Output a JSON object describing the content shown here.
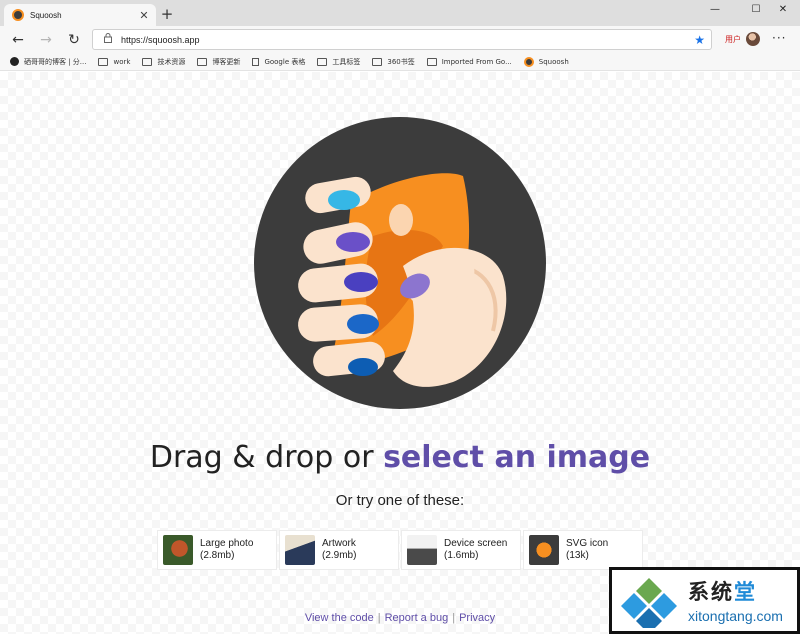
{
  "browser": {
    "tab_title": "Squoosh",
    "tab_close": "✕",
    "new_tab": "+",
    "window_controls": [
      "—",
      "☐",
      "✕"
    ],
    "nav": {
      "back": "←",
      "forward": "→",
      "refresh": "↻"
    },
    "url": "https://squoosh.app",
    "favorite_star": "★",
    "profile_label": "用户",
    "menu": "···",
    "bookmarks": [
      {
        "label": "硒哥哥的博客 | 分...",
        "icon": "circle-icon"
      },
      {
        "label": "work",
        "icon": "folder-icon"
      },
      {
        "label": "技术资源",
        "icon": "folder-icon"
      },
      {
        "label": "博客更新",
        "icon": "folder-icon"
      },
      {
        "label": "Google 表格",
        "icon": "page-icon"
      },
      {
        "label": "工具标签",
        "icon": "folder-icon"
      },
      {
        "label": "360书签",
        "icon": "folder-icon"
      },
      {
        "label": "Imported From Go...",
        "icon": "folder-icon"
      },
      {
        "label": "Squoosh",
        "icon": "squoosh-icon"
      }
    ]
  },
  "page": {
    "headline_prefix": "Drag & drop or ",
    "headline_link": "select an image",
    "subhead": "Or try one of these:",
    "samples": [
      {
        "name": "Large photo",
        "size": "(2.8mb)",
        "icon": "red-panda-thumb"
      },
      {
        "name": "Artwork",
        "size": "(2.9mb)",
        "icon": "artwork-thumb"
      },
      {
        "name": "Device screen",
        "size": "(1.6mb)",
        "icon": "device-screen-thumb"
      },
      {
        "name": "SVG icon",
        "size": "(13k)",
        "icon": "svg-icon-thumb"
      }
    ],
    "footer": {
      "view_code": "View the code",
      "report_bug": "Report a bug",
      "privacy": "Privacy"
    }
  },
  "watermark": {
    "name_prefix": "系统",
    "name_highlight": "堂",
    "domain": "xitongtang.com"
  },
  "colors": {
    "link_purple": "#5f4ea8",
    "squoosh_orange": "#f78f20",
    "hero_dark": "#3c3c3c"
  }
}
